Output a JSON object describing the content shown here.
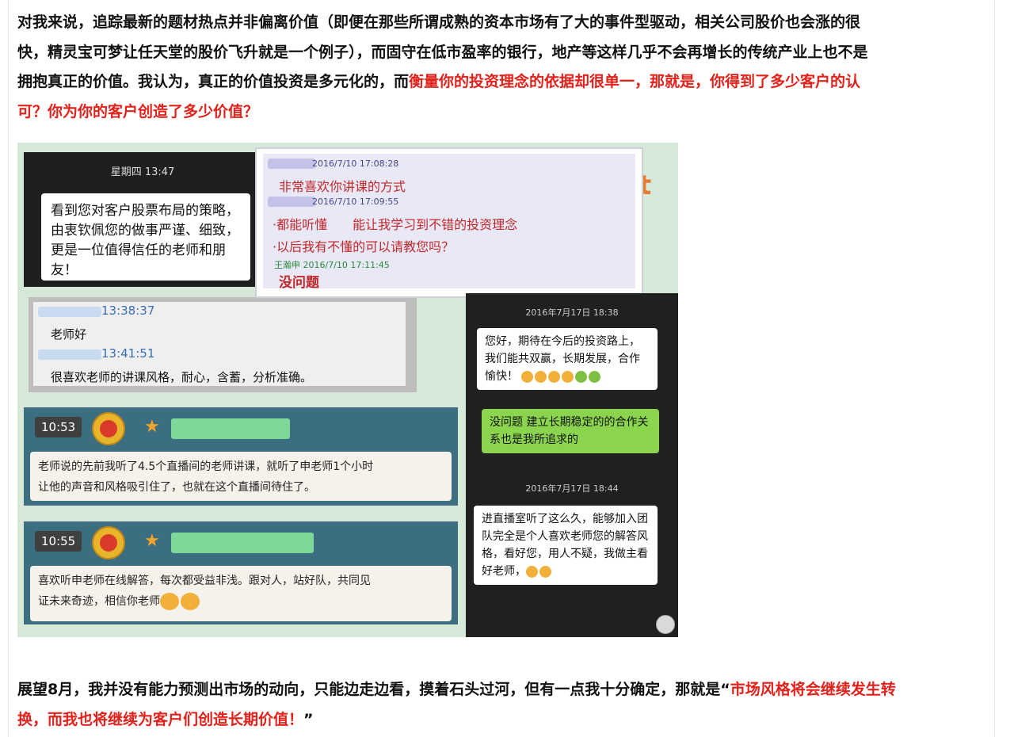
{
  "paragraph1": {
    "lines": [
      "对我来说，追踪最新的题材热点并非偏离价值（即便在那些所谓成熟的资本市场有了大的事件型驱动，相关公司股价也会涨的很",
      "快，精灵宝可梦让任天堂的股价飞升就是一个例子），而固守在低市盈率的银行，地产等这样几乎不会再增长的传统产业上也不是"
    ],
    "line3_black": "拥抱真正的价值。我认为，真正的价值投资是多元化的，而",
    "line3_red": "衡量你的投资理念的依据却很单一，那就是，你得到了多少客户的认",
    "line4_red": "可？你为你的客户创造了多少价值？"
  },
  "panel1": {
    "time": "星期四 13:47",
    "message": "看到您对客户股票布局的策略，由衷钦佩您的做事严谨、细致，更是一位值得信任的老师和朋友！"
  },
  "panel2": {
    "ts1": "2016/7/10 17:08:28",
    "msg1": "非常喜欢你讲课的方式",
    "ts2": "2016/7/10 17:09:55",
    "msg2": "·都能听懂　　能让我学习到不错的投资理念",
    "msg3": "·以后我有不懂的可以请教您吗？",
    "ts3": "王瀚申 2016/7/10 17:11:45",
    "msg4": "没问题"
  },
  "panel3": {
    "t1": "13:38:37",
    "msg1": "老师好",
    "t2": "13:41:51",
    "msg2": "很喜欢老师的讲课风格，耐心，含蓄，分析准确。"
  },
  "panel4": {
    "time": "10:53",
    "line1": "老师说的先前我听了4.5个直播间的老师讲课，就听了申老师1个小时",
    "line2": "让他的声音和风格吸引住了，也就在这个直播间待住了。"
  },
  "panel5": {
    "time": "10:55",
    "line1": "喜欢听申老师在线解答，每次都受益非浅。跟对人，站好队，共同见",
    "line2": "证未来奇迹，相信你老师"
  },
  "panel6": {
    "time1": "2016年7月17日 18:38",
    "msg1": "您好，期待在今后的投资路上，我们能共双赢，长期发展，合作愉快！",
    "msg2": "没问题 建立长期稳定的的合作关系也是我所追求的",
    "time2": "2016年7月17日 18:44",
    "msg3": "进直播室听了这么久，能够加入团队完全是个人喜欢老师您的解答风格，看好您，用人不疑，我做主看好老师，"
  },
  "paragraph2": {
    "black": "展望8月，我并没有能力预测出市场的动向，只能边走边看，摸着石头过河，但有一点我十分确定，那就是“",
    "red1": "市场风格将会继续发生转",
    "red2": "换，而我也将继续为客户们创造长期价值！",
    "end": "”"
  },
  "colors": {
    "accent_red": "#e2211b",
    "wechat_green": "#8bd44d"
  }
}
